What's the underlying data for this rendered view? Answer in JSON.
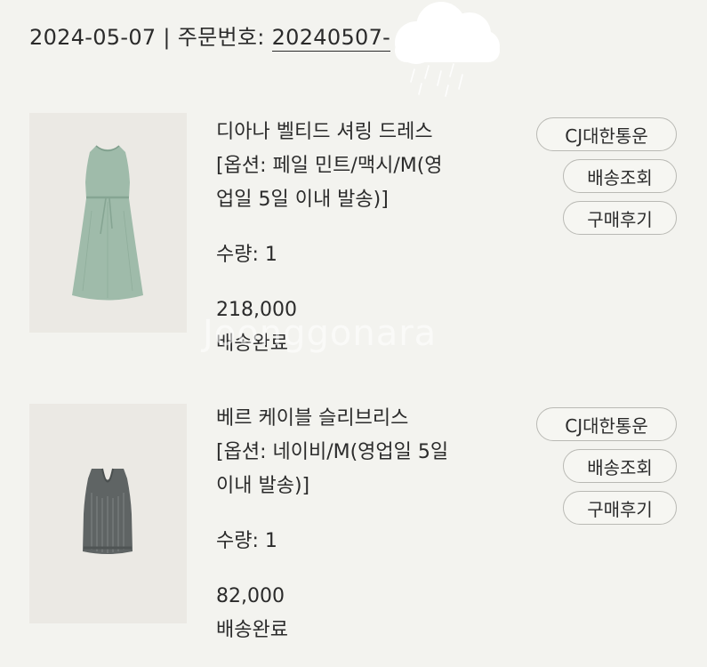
{
  "order": {
    "date": "2024-05-07",
    "separator": "|",
    "number_label": "주문번호:",
    "number_value": "20240507-"
  },
  "items": [
    {
      "name": "디아나 벨티드 셔링 드레스",
      "option_line1": "[옵션: 페일 민트/맥시/M(영",
      "option_line2": "업일 5일 이내 발송)]",
      "qty": "수량: 1",
      "price": "218,000",
      "status": "배송완료",
      "carrier_label": "CJ대한통운",
      "track_label": "배송조회",
      "review_label": "구매후기",
      "image_icon": "dress-icon",
      "image_color": "#9fbbaa"
    },
    {
      "name": "베르 케이블 슬리브리스",
      "option_line1": "[옵션: 네이비/M(영업일 5일",
      "option_line2": "이내 발송)]",
      "qty": "수량: 1",
      "price": "82,000",
      "status": "배송완료",
      "carrier_label": "CJ대한통운",
      "track_label": "배송조회",
      "review_label": "구매후기",
      "image_icon": "knit-vest-icon",
      "image_color": "#5f6464"
    }
  ],
  "watermark": "Joonggonara",
  "colors": {
    "background": "#f3f3ef",
    "text": "#2b2b2b",
    "button_border": "#b9b9b4"
  }
}
